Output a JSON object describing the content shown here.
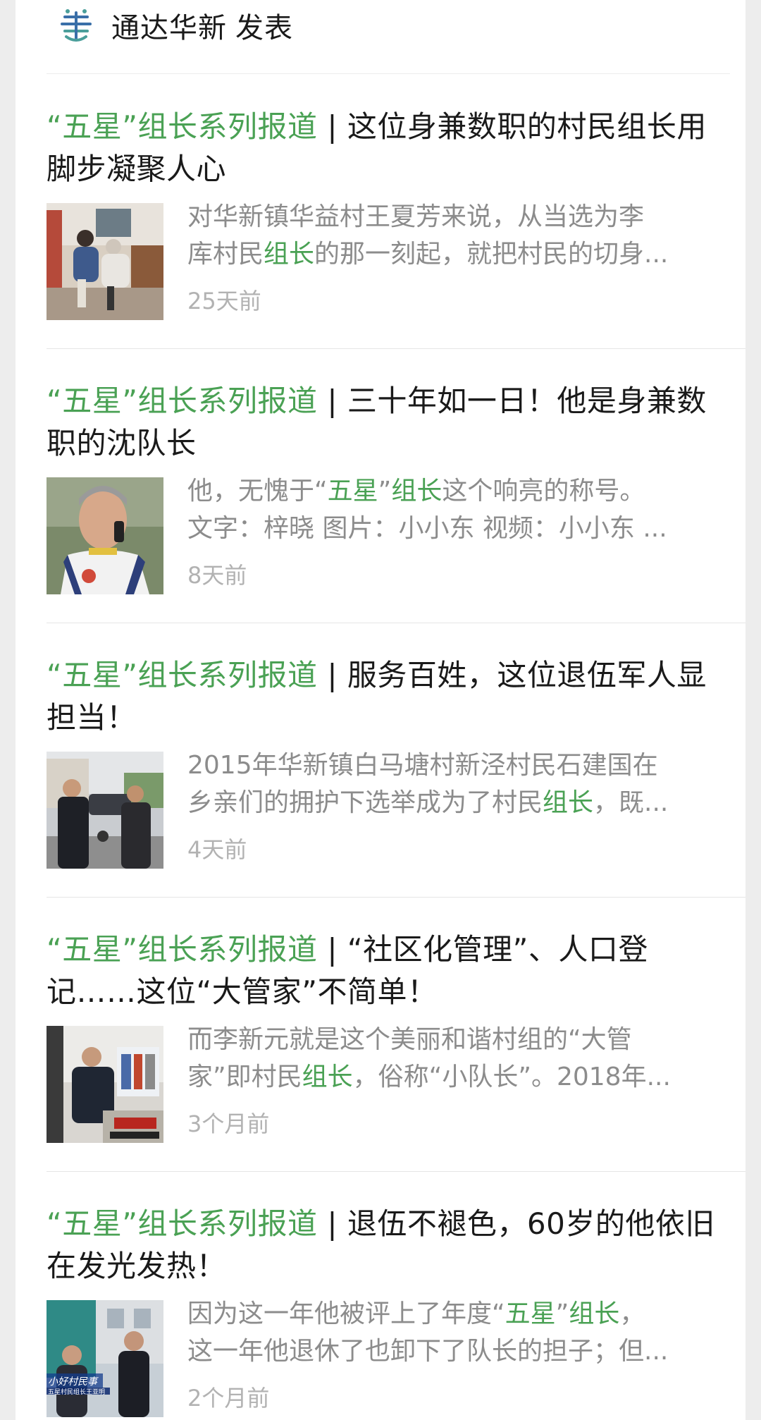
{
  "header": {
    "account_name": "通达华新",
    "action": "发表"
  },
  "articles": [
    {
      "title": {
        "open_quote": "“",
        "wuxing": "五星",
        "close_quote": "”",
        "series": "组长系列报道",
        "rest": " | 这位身兼数职的村民组长用脚步凝聚人心"
      },
      "desc": {
        "line1": "对华新镇华益村王夏芳来说，从当选为李",
        "line2_pre": "库村民",
        "line2_hl": "组长",
        "line2_post": "的那一刻起，就把村民的切身..."
      },
      "time": "25天前"
    },
    {
      "title": {
        "open_quote": "“",
        "wuxing": "五星",
        "close_quote": "”",
        "series": "组长系列报道",
        "rest": " | 三十年如一日！他是身兼数职的沈队长"
      },
      "desc": {
        "line1_pre": "他，无愧于“",
        "line1_hl1": "五星",
        "line1_mid": "”",
        "line1_hl2": "组长",
        "line1_post": "这个响亮的称号。",
        "line2": "文字：梓晓 图片：小小东 视频：小小东 ..."
      },
      "time": "8天前"
    },
    {
      "title": {
        "open_quote": "“",
        "wuxing": "五星",
        "close_quote": "”",
        "series": "组长系列报道",
        "rest": " | 服务百姓，这位退伍军人显担当！"
      },
      "desc": {
        "line1": "2015年华新镇白马塘村新泾村民石建国在",
        "line2_pre": "乡亲们的拥护下选举成为了村民",
        "line2_hl": "组长",
        "line2_post": "，既..."
      },
      "time": "4天前"
    },
    {
      "title": {
        "open_quote": "“",
        "wuxing": "五星",
        "close_quote": "”",
        "series": "组长系列报道",
        "rest": " | “社区化管理”、人口登记……这位“大管家”不简单！"
      },
      "desc": {
        "line1": "而李新元就是这个美丽和谐村组的“大管",
        "line2_pre": "家”即村民",
        "line2_hl": "组长",
        "line2_post": "，俗称“小队长”。2018年..."
      },
      "time": "3个月前"
    },
    {
      "title": {
        "open_quote": "“",
        "wuxing": "五星",
        "close_quote": "”",
        "series": "组长系列报道",
        "rest": " | 退伍不褪色，60岁的他依旧在发光发热！"
      },
      "desc": {
        "line1_pre": "因为这一年他被评上了年度“",
        "line1_hl1": "五星",
        "line1_mid": "”",
        "line1_hl2": "组长",
        "line1_post": "，",
        "line2": "这一年他退休了也卸下了队长的担子；但..."
      },
      "time": "2个月前",
      "thumb_caption_top": "小好村民事",
      "thumb_caption_bottom": "五星村民组长王亚明"
    }
  ],
  "colors": {
    "accent_green": "#4aa154",
    "logo_blue": "#3a6fa8",
    "logo_teal": "#4a9e9a"
  }
}
